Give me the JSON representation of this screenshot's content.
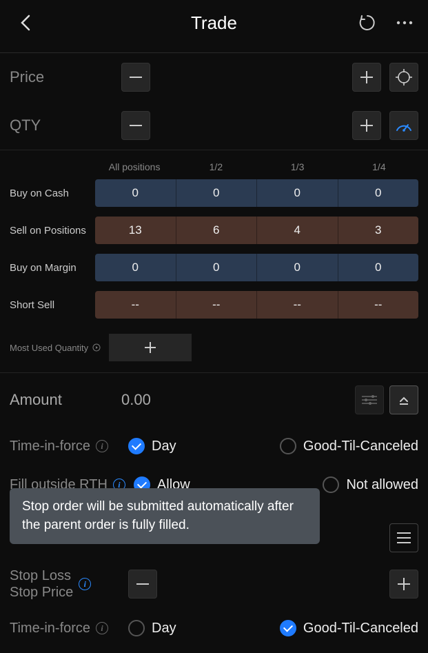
{
  "header": {
    "title": "Trade"
  },
  "price": {
    "label": "Price"
  },
  "qty": {
    "label": "QTY"
  },
  "positions": {
    "headers": [
      "All positions",
      "1/2",
      "1/3",
      "1/4"
    ],
    "rows": [
      {
        "label": "Buy on Cash",
        "style": "blue",
        "cells": [
          "0",
          "0",
          "0",
          "0"
        ]
      },
      {
        "label": "Sell on Positions",
        "style": "brown",
        "cells": [
          "13",
          "6",
          "4",
          "3"
        ]
      },
      {
        "label": "Buy on Margin",
        "style": "blue",
        "cells": [
          "0",
          "0",
          "0",
          "0"
        ]
      },
      {
        "label": "Short Sell",
        "style": "brown",
        "cells": [
          "--",
          "--",
          "--",
          "--"
        ]
      }
    ]
  },
  "mostUsed": {
    "label": "Most Used Quantity"
  },
  "amount": {
    "label": "Amount",
    "value": "0.00"
  },
  "tif": {
    "label": "Time-in-force",
    "opt1": "Day",
    "opt2": "Good-Til-Canceled",
    "selected": 0
  },
  "fill": {
    "label": "Fill outside RTH",
    "opt1": "Allow",
    "opt2": "Not allowed",
    "selected": 0
  },
  "tooltip": "Stop order will be submitted automatically after the parent order is fully filled.",
  "stoploss": {
    "line1": "Stop Loss",
    "line2": "Stop Price"
  },
  "tif2": {
    "label": "Time-in-force",
    "opt1": "Day",
    "opt2": "Good-Til-Canceled",
    "selected": 1
  }
}
